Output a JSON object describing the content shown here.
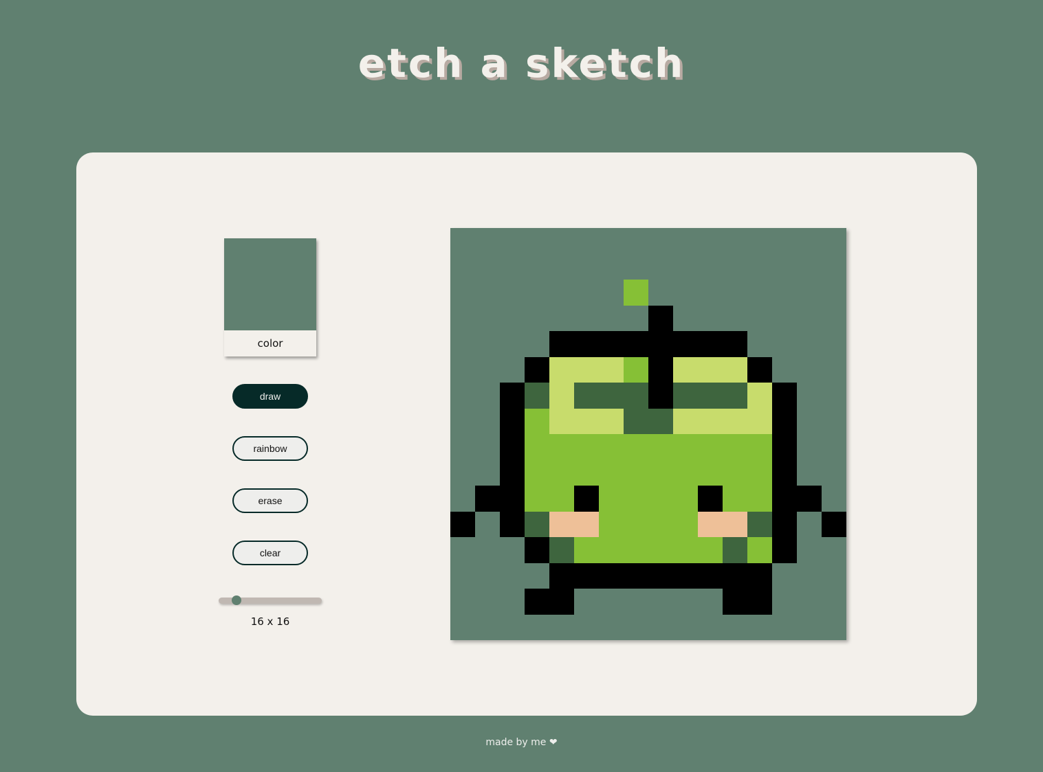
{
  "header": {
    "title": "etch a sketch"
  },
  "controls": {
    "color_label": "color",
    "current_color": "#608070",
    "buttons": [
      {
        "id": "draw",
        "label": "draw",
        "active": true
      },
      {
        "id": "rainbow",
        "label": "rainbow",
        "active": false
      },
      {
        "id": "erase",
        "label": "erase",
        "active": false
      },
      {
        "id": "clear",
        "label": "clear",
        "active": false
      }
    ],
    "grid_size": {
      "value": 16,
      "label": "16 x 16",
      "slider_fraction": 0.14
    }
  },
  "canvas": {
    "size": 16,
    "palette": {
      "0": "#608070",
      "1": "#000000",
      "2": "#86c036",
      "3": "#c8dc6c",
      "4": "#3e653e",
      "5": "#eec098"
    },
    "rows": [
      "0000000000000000",
      "0000000000000000",
      "0000000200000000",
      "0000000010000000",
      "0000111111110000",
      "0001333213331000",
      "0014344414443100",
      "0012333443333100",
      "0012222222222100",
      "0012222222222100",
      "0112212222122110",
      "1014552222554101",
      "0001422222242100",
      "0000111111111000",
      "0001100000011000",
      "0000000000000000"
    ]
  },
  "footer": {
    "text": "made by me ❤"
  }
}
